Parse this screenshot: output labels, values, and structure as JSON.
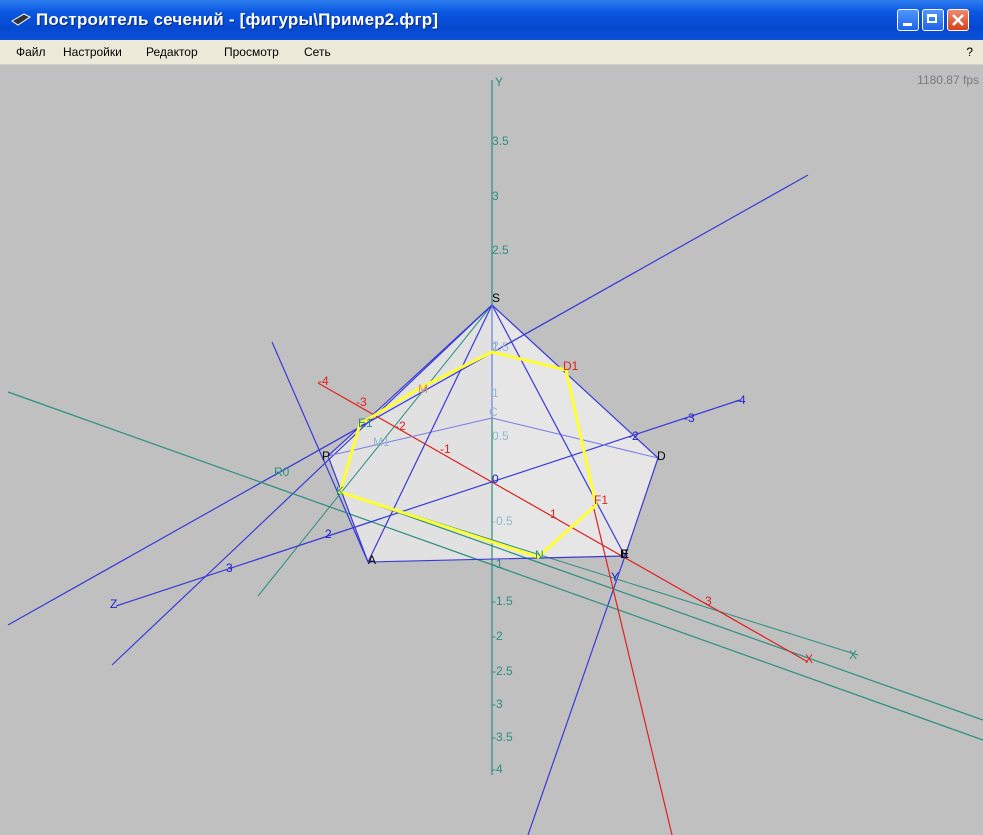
{
  "window": {
    "title": "Построитель сечений - [фигуры\\Пример2.фгр]"
  },
  "menu": {
    "items": [
      "Файл",
      "Настройки",
      "Редактор",
      "Просмотр",
      "Сеть"
    ],
    "help": "?"
  },
  "viewport": {
    "fps": "1180.87 fps"
  },
  "axes": {
    "y": {
      "name": "Y",
      "ticks": [
        "3.5",
        "3",
        "2.5",
        "2",
        "1.5",
        "1",
        "0.5",
        "0",
        "-0.5",
        "-1",
        "-1.5",
        "-2",
        "-2.5",
        "-3",
        "-3.5",
        "-4"
      ]
    },
    "x": {
      "name": "X",
      "ticks": [
        "-4",
        "-3",
        "-2",
        "-1",
        "1",
        "3"
      ]
    },
    "z": {
      "name": "Z",
      "ticks": [
        "-4",
        "-3",
        "-2",
        "2",
        "3"
      ]
    }
  },
  "points": {
    "apex": "S",
    "base": [
      "A",
      "B",
      "C",
      "D",
      "E"
    ],
    "section": [
      "D1",
      "E1",
      "F1",
      "K",
      "M",
      "M1",
      "N",
      "P",
      "R0",
      "Y",
      "X"
    ]
  },
  "colors": {
    "background": "#c0c0c0",
    "axis_y": "#2b8f7f",
    "axis_x": "#e02020",
    "axis_z": "#2020d0",
    "edge": "#3a3ad8",
    "section": "#ffff33"
  }
}
